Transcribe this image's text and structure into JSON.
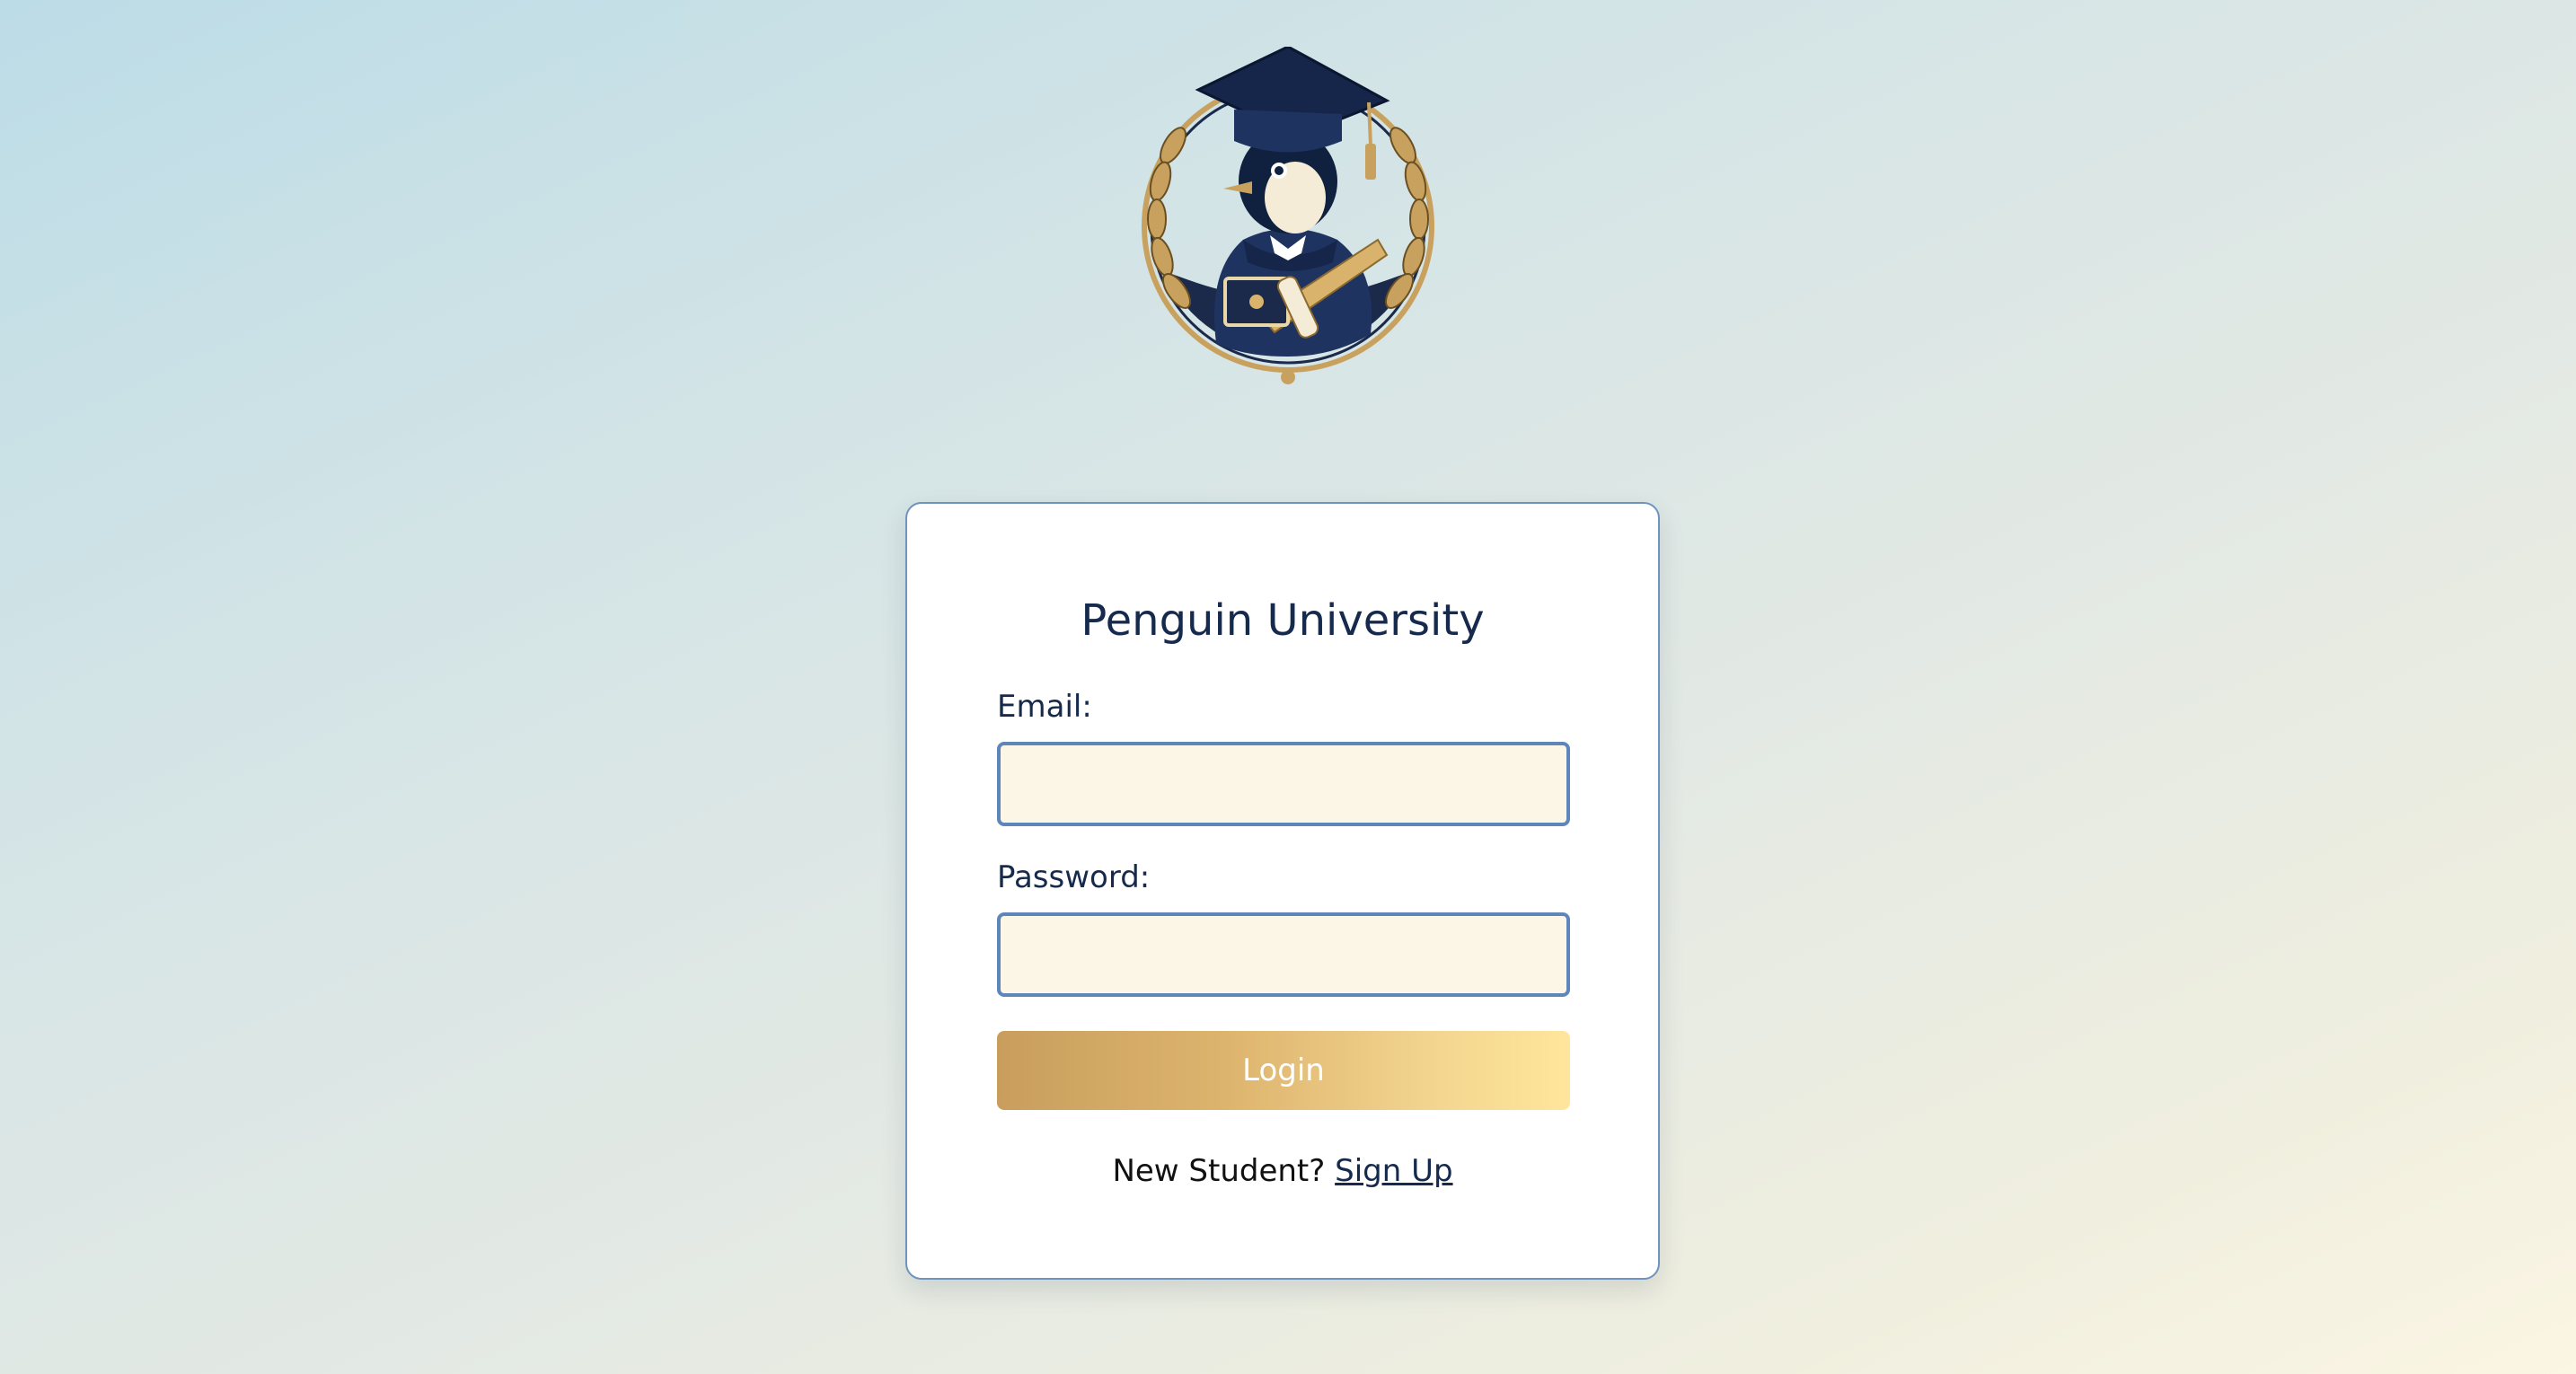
{
  "logo": {
    "name": "penguin-graduate-crest-logo"
  },
  "login_card": {
    "title": "Penguin University",
    "email_label": "Email:",
    "email_value": "",
    "password_label": "Password:",
    "password_value": "",
    "login_button_label": "Login",
    "signup_prompt": "New Student?",
    "signup_link_label": "Sign Up"
  },
  "colors": {
    "primary_navy": "#152a4d",
    "input_border": "#5f86ba",
    "input_background": "#fbf6e6",
    "button_gradient_start": "#c99e5d",
    "button_gradient_end": "#ffe69c",
    "background_start": "#bcdce7",
    "background_end": "#fbf5e3"
  }
}
